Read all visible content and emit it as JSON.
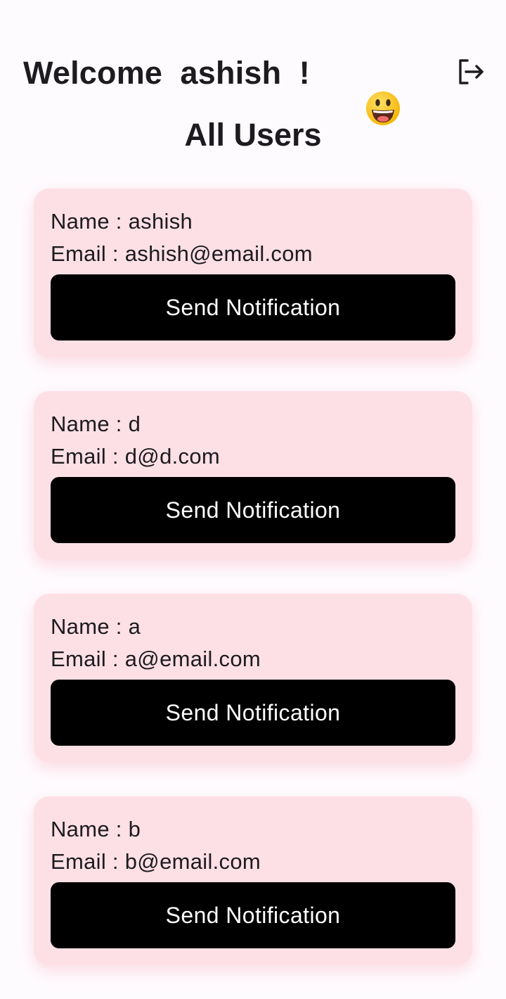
{
  "header": {
    "welcome_text": "Welcome  ashish  !",
    "emoji_icon": "smiling-face-emoji",
    "logout_icon": "logout-icon"
  },
  "page_title": "All Users",
  "users": [
    {
      "name_line": "Name : ashish",
      "email_line": "Email : ashish@email.com",
      "button_label": "Send Notification"
    },
    {
      "name_line": "Name : d",
      "email_line": "Email : d@d.com",
      "button_label": "Send Notification"
    },
    {
      "name_line": "Name : a",
      "email_line": "Email : a@email.com",
      "button_label": "Send Notification"
    },
    {
      "name_line": "Name : b",
      "email_line": "Email : b@email.com",
      "button_label": "Send Notification"
    }
  ],
  "colors": {
    "background": "#fefbfe",
    "card": "#fde0e6",
    "button": "#000000",
    "button_text": "#ffffff",
    "text": "#1d1b20"
  }
}
